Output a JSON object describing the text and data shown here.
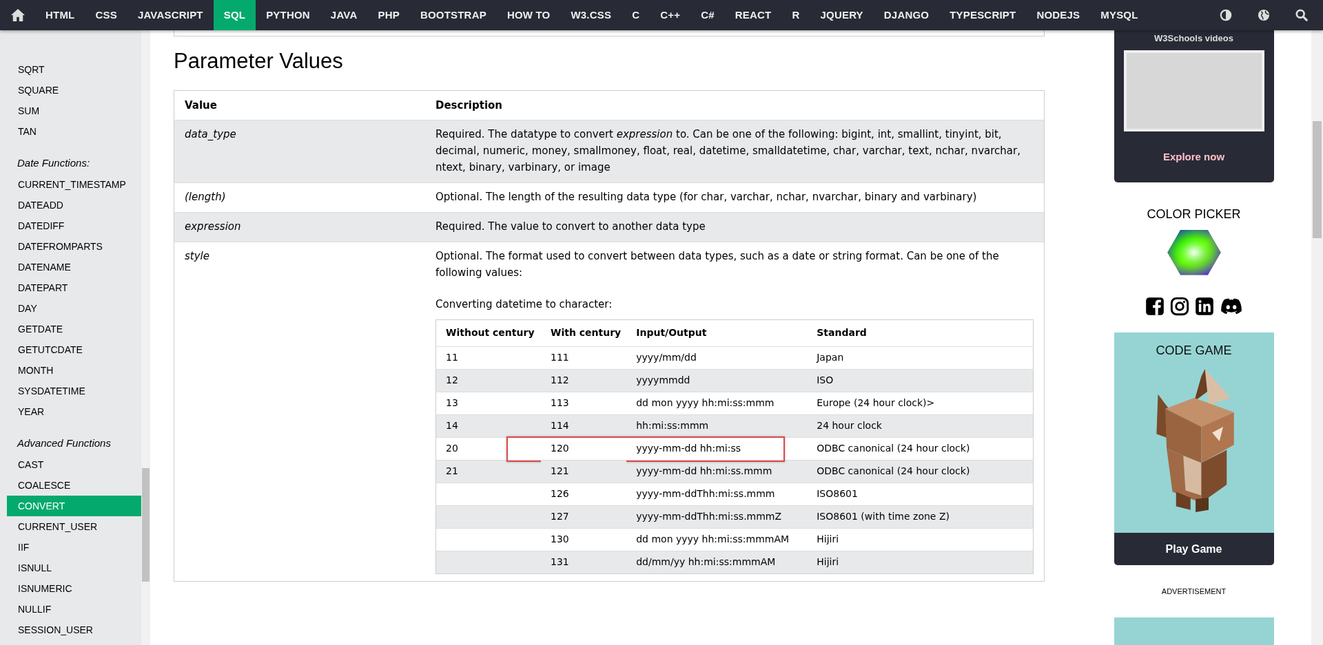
{
  "nav": {
    "items": [
      {
        "label": "HTML",
        "selected": false
      },
      {
        "label": "CSS",
        "selected": false
      },
      {
        "label": "JAVASCRIPT",
        "selected": false
      },
      {
        "label": "SQL",
        "selected": true
      },
      {
        "label": "PYTHON",
        "selected": false
      },
      {
        "label": "JAVA",
        "selected": false
      },
      {
        "label": "PHP",
        "selected": false
      },
      {
        "label": "BOOTSTRAP",
        "selected": false
      },
      {
        "label": "HOW TO",
        "selected": false
      },
      {
        "label": "W3.CSS",
        "selected": false
      },
      {
        "label": "C",
        "selected": false
      },
      {
        "label": "C++",
        "selected": false
      },
      {
        "label": "C#",
        "selected": false
      },
      {
        "label": "REACT",
        "selected": false
      },
      {
        "label": "R",
        "selected": false
      },
      {
        "label": "JQUERY",
        "selected": false
      },
      {
        "label": "DJANGO",
        "selected": false
      },
      {
        "label": "TYPESCRIPT",
        "selected": false
      },
      {
        "label": "NODEJS",
        "selected": false
      },
      {
        "label": "MYSQL",
        "selected": false
      }
    ]
  },
  "sidebar": {
    "sections": [
      {
        "items": [
          {
            "label": "SQRT",
            "selected": false
          },
          {
            "label": "SQUARE",
            "selected": false
          },
          {
            "label": "SUM",
            "selected": false
          },
          {
            "label": "TAN",
            "selected": false
          }
        ]
      },
      {
        "heading": "Date Functions:",
        "items": [
          {
            "label": "CURRENT_TIMESTAMP",
            "selected": false
          },
          {
            "label": "DATEADD",
            "selected": false
          },
          {
            "label": "DATEDIFF",
            "selected": false
          },
          {
            "label": "DATEFROMPARTS",
            "selected": false
          },
          {
            "label": "DATENAME",
            "selected": false
          },
          {
            "label": "DATEPART",
            "selected": false
          },
          {
            "label": "DAY",
            "selected": false
          },
          {
            "label": "GETDATE",
            "selected": false
          },
          {
            "label": "GETUTCDATE",
            "selected": false
          },
          {
            "label": "MONTH",
            "selected": false
          },
          {
            "label": "SYSDATETIME",
            "selected": false
          },
          {
            "label": "YEAR",
            "selected": false
          }
        ]
      },
      {
        "heading": "Advanced Functions",
        "items": [
          {
            "label": "CAST",
            "selected": false
          },
          {
            "label": "COALESCE",
            "selected": false
          },
          {
            "label": "CONVERT",
            "selected": true
          },
          {
            "label": "CURRENT_USER",
            "selected": false
          },
          {
            "label": "IIF",
            "selected": false
          },
          {
            "label": "ISNULL",
            "selected": false
          },
          {
            "label": "ISNUMERIC",
            "selected": false
          },
          {
            "label": "NULLIF",
            "selected": false
          },
          {
            "label": "SESSION_USER",
            "selected": false
          }
        ]
      }
    ]
  },
  "main": {
    "heading": "Parameter Values",
    "table": {
      "columns": [
        "Value",
        "Description"
      ],
      "rows": [
        {
          "value": "data_type",
          "description": "Required. The datatype to convert *expression* to. Can be one of the following: bigint, int, smallint, tinyint, bit, decimal, numeric, money, smallmoney, float, real, datetime, smalldatetime, char, varchar, text, nchar, nvarchar, ntext, binary, varbinary, or image"
        },
        {
          "value": "(length)",
          "description": "Optional. The length of the resulting data type (for char, varchar, nchar, nvarchar, binary and varbinary)"
        },
        {
          "value": "expression",
          "description": "Required. The value to convert to another data type"
        },
        {
          "value": "style",
          "description": "Optional. The format used to convert between data types, such as a date or string format. Can be one of the following values:",
          "note": "Converting datetime to character:",
          "subtable": {
            "columns": [
              "Without century",
              "With century",
              "Input/Output",
              "Standard"
            ],
            "rows": [
              {
                "without_century": "11",
                "with_century": "111",
                "input_output": "yyyy/mm/dd",
                "standard": "Japan",
                "highlighted": false
              },
              {
                "without_century": "12",
                "with_century": "112",
                "input_output": "yyyymmdd",
                "standard": "ISO",
                "highlighted": false
              },
              {
                "without_century": "13",
                "with_century": "113",
                "input_output": "dd mon yyyy hh:mi:ss:mmm",
                "standard": "Europe (24 hour clock)>",
                "highlighted": false
              },
              {
                "without_century": "14",
                "with_century": "114",
                "input_output": "hh:mi:ss:mmm",
                "standard": "24 hour clock",
                "highlighted": false
              },
              {
                "without_century": "20",
                "with_century": "120",
                "input_output": "yyyy-mm-dd hh:mi:ss",
                "standard": "ODBC canonical (24 hour clock)",
                "highlighted": true
              },
              {
                "without_century": "21",
                "with_century": "121",
                "input_output": "yyyy-mm-dd hh:mi:ss.mmm",
                "standard": "ODBC canonical (24 hour clock)",
                "highlighted": false
              },
              {
                "with_century": "126",
                "input_output": "yyyy-mm-ddThh:mi:ss.mmm",
                "standard": "ISO8601",
                "highlighted": false
              },
              {
                "with_century": "127",
                "input_output": "yyyy-mm-ddThh:mi:ss.mmmZ",
                "standard": "ISO8601 (with time zone Z)",
                "highlighted": false
              },
              {
                "with_century": "130",
                "input_output": "dd mon yyyy hh:mi:ss:mmmAM",
                "standard": "Hijiri",
                "highlighted": false
              },
              {
                "with_century": "131",
                "input_output": "dd/mm/yy hh:mi:ss:mmmAM",
                "standard": "Hijiri",
                "highlighted": false
              }
            ]
          }
        }
      ]
    }
  },
  "right": {
    "video_ad": {
      "title": "W3Schools videos",
      "link": "Explore now"
    },
    "color_picker": {
      "title": "COLOR PICKER"
    },
    "code_game": {
      "title": "CODE GAME",
      "button": "Play Game"
    },
    "advertisement": "ADVERTISEMENT"
  }
}
